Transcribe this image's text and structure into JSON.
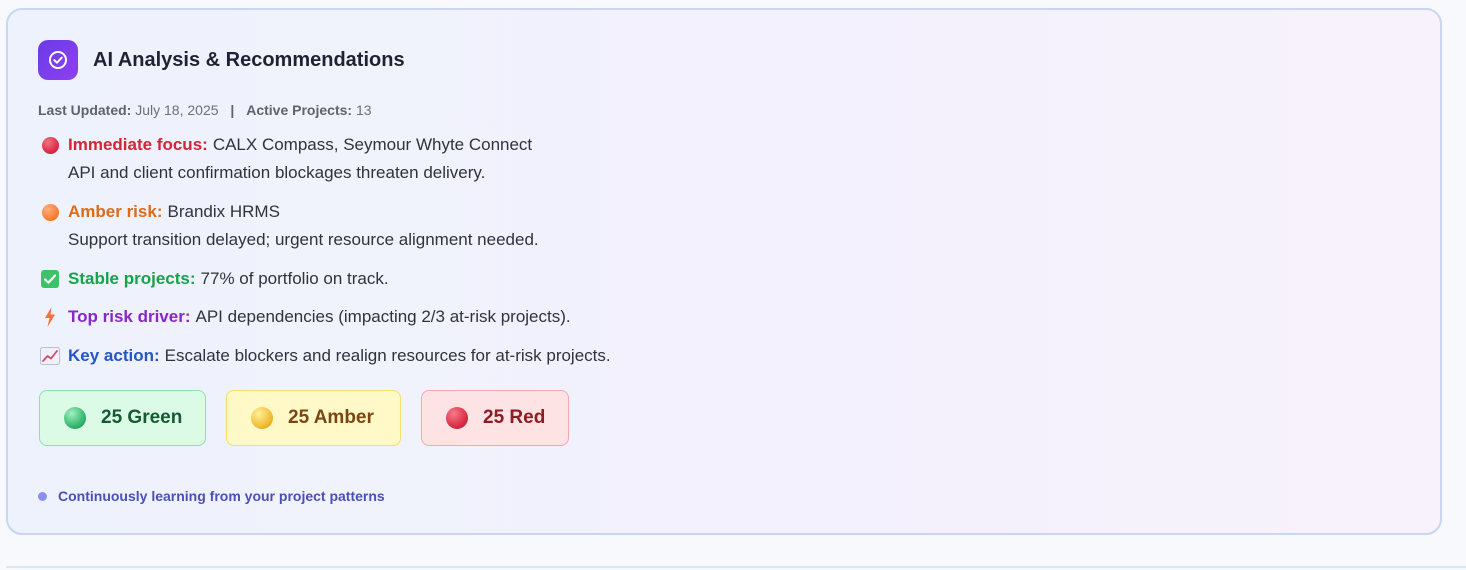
{
  "card": {
    "title": "AI Analysis & Recommendations",
    "meta": {
      "last_updated_label": "Last Updated:",
      "last_updated_value": "July 18, 2025",
      "separator": "|",
      "active_projects_label": "Active Projects:",
      "active_projects_value": "13"
    },
    "insights": [
      {
        "icon": "red-circle-icon",
        "label": "Immediate focus:",
        "label_color": "#d62437",
        "text": "CALX Compass, Seymour Whyte Connect",
        "detail": "API and client confirmation blockages threaten delivery."
      },
      {
        "icon": "orange-circle-icon",
        "label": "Amber risk:",
        "label_color": "#dd6b17",
        "text": "Brandix HRMS",
        "detail": "Support transition delayed; urgent resource alignment needed."
      },
      {
        "icon": "check-mark-button-icon",
        "label": "Stable projects:",
        "label_color": "#16a34a",
        "text": "77% of portfolio on track."
      },
      {
        "icon": "lightning-icon",
        "label": "Top risk driver:",
        "label_color": "#8a25c8",
        "text": "API dependencies (impacting 2/3 at-risk projects)."
      },
      {
        "icon": "chart-increasing-icon",
        "label": "Key action:",
        "label_color": "#2456c8",
        "text": "Escalate blockers and realign resources for at-risk projects."
      }
    ],
    "status_pills": [
      {
        "label": "25 Green",
        "color": "#155a31"
      },
      {
        "label": "25 Amber",
        "color": "#7b4614"
      },
      {
        "label": "25 Red",
        "color": "#8e1c22"
      }
    ],
    "footer": "Continuously learning from your project patterns"
  }
}
